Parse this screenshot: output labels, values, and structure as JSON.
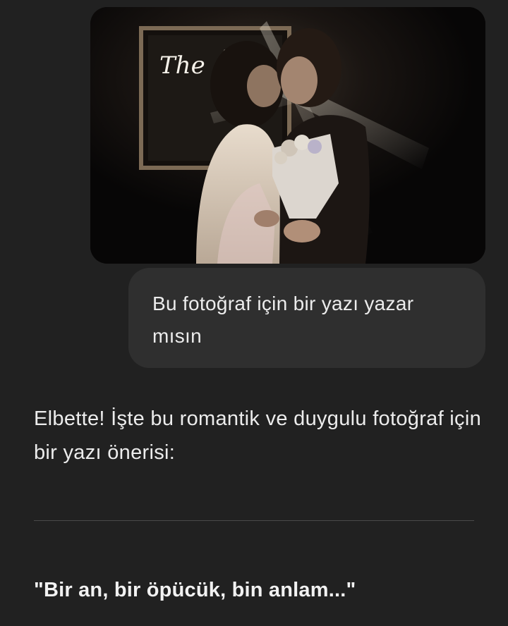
{
  "chat": {
    "user_message": {
      "image_alt_icon": "photo-image",
      "neon_sign_text": "The ey",
      "text": "Bu fotoğraf için bir yazı yazar mısın"
    },
    "assistant_message": {
      "intro": "Elbette! İşte bu romantik ve duygulu fotoğraf için bir yazı önerisi:",
      "quote": "\"Bir an, bir öpücük, bin anlam...\""
    }
  },
  "colors": {
    "background": "#212121",
    "user_bubble": "#2f2f2f",
    "text": "#ececec",
    "divider": "#4a4a4a"
  }
}
